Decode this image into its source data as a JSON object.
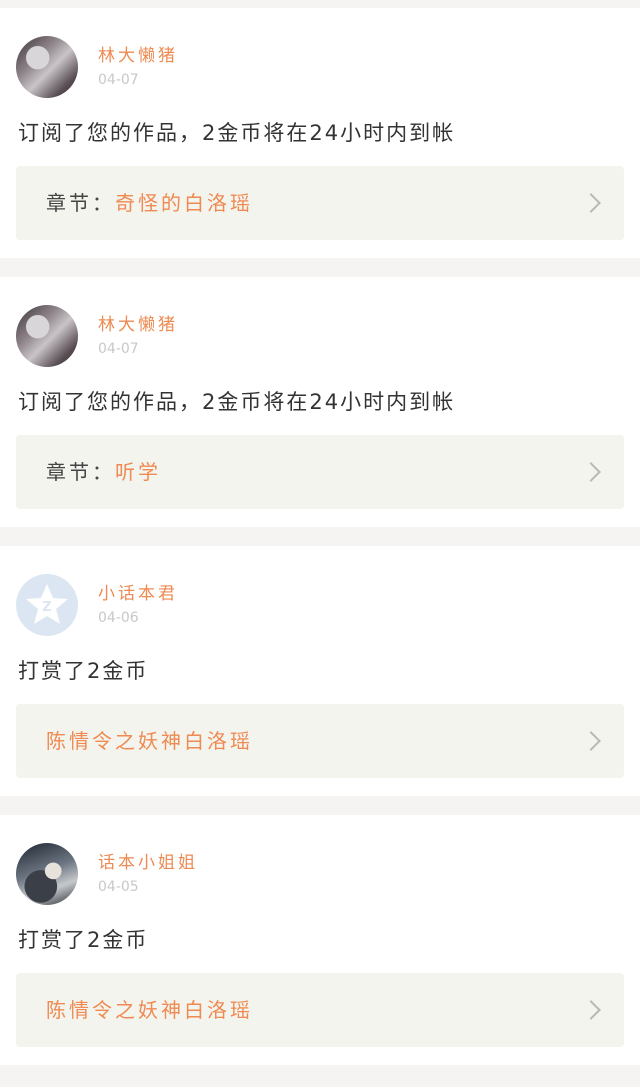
{
  "feed": [
    {
      "user": "林大懒猪",
      "date": "04-07",
      "avatar": "photo-avatar",
      "message": "订阅了您的作品，2金币将在24小时内到帐",
      "detail_label": "章节：",
      "detail_value": "奇怪的白洛瑶"
    },
    {
      "user": "林大懒猪",
      "date": "04-07",
      "avatar": "photo-avatar",
      "message": "订阅了您的作品，2金币将在24小时内到帐",
      "detail_label": "章节：",
      "detail_value": "听学"
    },
    {
      "user": "小话本君",
      "date": "04-06",
      "avatar": "qq-default-avatar",
      "message": "打赏了2金币",
      "detail_label": "",
      "detail_value": "陈情令之妖神白洛瑶"
    },
    {
      "user": "话本小姐姐",
      "date": "04-05",
      "avatar": "photo-avatar",
      "message": "打赏了2金币",
      "detail_label": "",
      "detail_value": "陈情令之妖神白洛瑶"
    }
  ],
  "colors": {
    "accent": "#ee8a52",
    "card_background": "#ffffff",
    "detail_background": "#f4f4ee",
    "page_background": "#f5f4f2"
  },
  "icons": {
    "chevron": "chevron-right-icon"
  }
}
